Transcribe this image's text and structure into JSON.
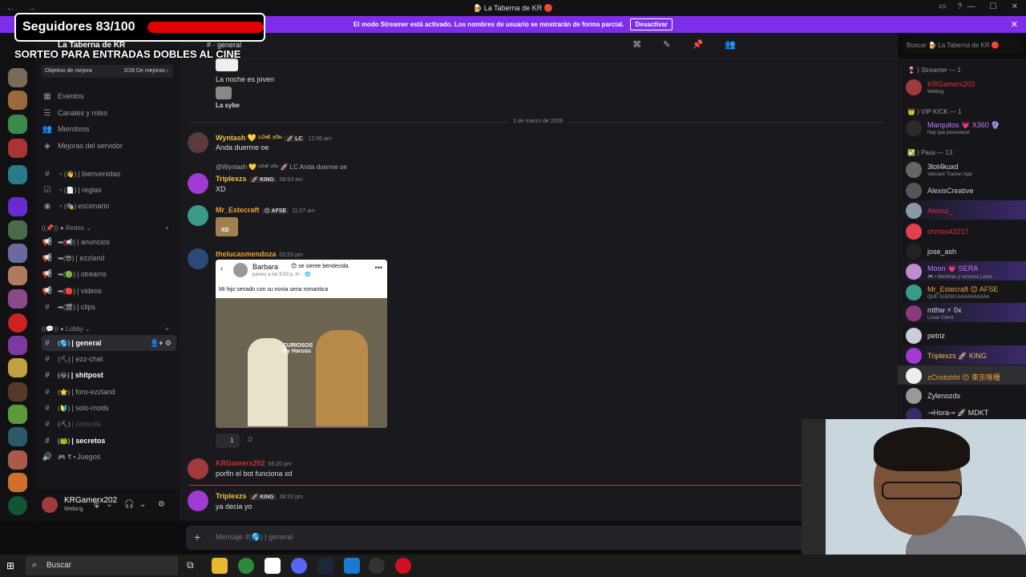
{
  "titlebar": {
    "title": "🍺 La Taberna de KR 🔴",
    "nav": "← →"
  },
  "streamer_banner": {
    "text": "El modo Streamer está activado. Los nombres de usuario se mostrarán de forma parcial.",
    "button": "Desactivar"
  },
  "overlay": {
    "followers": "Seguidores 83/100",
    "followers_current": 83,
    "followers_goal": 100,
    "sorteo": "SORTEO PARA ENTRADAS DOBLES AL CINE"
  },
  "server": {
    "name": "La Taberna de KR",
    "goal_label": "Objetivo de mejora",
    "goal_value": "2/28 De mejoras ›"
  },
  "sidebar": {
    "top_items": [
      {
        "icon": "▦",
        "label": "Eventos"
      },
      {
        "icon": "☰",
        "label": "Canales y roles"
      },
      {
        "icon": "👥",
        "label": "Miembros"
      },
      {
        "icon": "◈",
        "label": "Mejoras del servidor"
      }
    ],
    "channels_a": [
      {
        "icon": "#",
        "emoji": "・(👋)",
        "label": "| bienvenidas"
      },
      {
        "icon": "☑",
        "emoji": "・(📄)",
        "label": "| reglas"
      },
      {
        "icon": "◉",
        "emoji": "・(🎭)",
        "label": "escenario"
      }
    ],
    "cat_redes": "((📌)) ● Redes ⌄",
    "channels_redes": [
      {
        "icon": "📢",
        "emoji": "➡(📢)",
        "label": "| anuncios"
      },
      {
        "icon": "📢",
        "emoji": "➡(😎)",
        "label": "| ezzland"
      },
      {
        "icon": "📢",
        "emoji": "➡(🟢)",
        "label": "| streams"
      },
      {
        "icon": "📢",
        "emoji": "➡(🔴)",
        "label": "| videos"
      },
      {
        "icon": "#",
        "emoji": "➡(🎬)",
        "label": "| clips"
      }
    ],
    "cat_lobby": "((💬)) ● Lobby ⌄",
    "channels_lobby": [
      {
        "icon": "#",
        "emoji": "(🌎)",
        "label": "| general",
        "state": "active"
      },
      {
        "icon": "#",
        "emoji": "(⛏)",
        "label": "| ezz-chat",
        "state": "normal"
      },
      {
        "icon": "#",
        "emoji": "(😂)",
        "label": "| shitpost",
        "state": "bold"
      },
      {
        "icon": "#",
        "emoji": "(🌟)",
        "label": "| foro-ezzland",
        "state": "normal"
      },
      {
        "icon": "#",
        "emoji": "(🔰)",
        "label": "| solo-mods",
        "state": "normal"
      },
      {
        "icon": "#",
        "emoji": "(⛏)",
        "label": "| consola",
        "state": "dim"
      },
      {
        "icon": "#",
        "emoji": "(🐸)",
        "label": "| secretos",
        "state": "bold"
      },
      {
        "icon": "🔊",
        "emoji": "🎮 ₹ •",
        "label": "Juegos",
        "state": "normal"
      }
    ]
  },
  "user": {
    "name": "KRGamerx202",
    "status": "Webing"
  },
  "channel_header": {
    "name": "general"
  },
  "search": {
    "placeholder": "Buscar 🍺 La Taberna de KR 🔴"
  },
  "messages": {
    "m0_text": "La noche es joven",
    "m0_user": "La sybe",
    "date_divider": "1 de marzo de 2026",
    "m1": {
      "user": "Wyntash 💛 ᴸᴼᵛᴱ ʸᴼᵘ",
      "tag": "🚀 LC",
      "time": "12:06 am",
      "text": "Anda duerme oe"
    },
    "m2": {
      "reply": "@Wyntash 💛 ᴸᴼᵛᴱ ʸᴼᵘ  🚀 LC  Anda duerme oe",
      "user": "Triplexzs",
      "tag": "🚀 KING",
      "time": "08:53 am",
      "text": "XD"
    },
    "m3": {
      "user": "Mr_Estecraft",
      "tag": "😊 AFSE",
      "time": "11:27 am",
      "text": "XD"
    },
    "m4": {
      "user": "thelucasmendoza",
      "time": "03:53 pm",
      "meme_name": "Barbara",
      "meme_feel": "😊 se siente bendecida.",
      "meme_when": "jueves a las 9:53 p. m. · 🌐",
      "meme_caption": "Mi hijo senado con su novia sena romantica",
      "meme_watermark": "CURIOSOS By Harusu",
      "reaction_count": "1"
    },
    "m5": {
      "user": "KRGamerx202",
      "time": "08:20 pm",
      "text": "porfin el bot funciona xd"
    },
    "m6": {
      "user": "Triplexzs",
      "tag": "🚀 KING",
      "time": "08:20 pm",
      "text": "ya decia yo"
    }
  },
  "input": {
    "placeholder": "Mensaje #(🌎) | general"
  },
  "members": {
    "cat_streamer": "🍷 ) Streamer — 1",
    "cat_vip": "👑 ) VIP KICK — 1",
    "cat_pass": "✅ ) Pass — 13",
    "list": [
      {
        "name": "KRGamerx202",
        "sub": "Webing",
        "color": "#e03030"
      },
      {
        "name": "Marquitos 💗 X360 🔮",
        "sub": "Hay que perseverar",
        "color": "#c57bff"
      },
      {
        "name": "3lot4kuxd",
        "sub": "Valorant Tracker App",
        "color": "#ddd"
      },
      {
        "name": "AlexisCreative",
        "sub": "",
        "color": "#ccc"
      },
      {
        "name": "Alexsz_",
        "sub": "",
        "color": "#e03030"
      },
      {
        "name": "christo43217",
        "sub": "",
        "color": "#e03030"
      },
      {
        "name": "jose_ash",
        "sub": "",
        "color": "#ddd"
      },
      {
        "name": "Moon 💗 SERA",
        "sub": "🎮 • Mentiras y censura Lunar...",
        "color": "#c57bff"
      },
      {
        "name": "Mr_Estecraft 😊 AFSE",
        "sub": "QUE SUENO AAAAAAAAAA",
        "color": "#f0a030"
      },
      {
        "name": "mthw ⚡ 0x",
        "sub": "Lunar Client",
        "color": "#ddd"
      },
      {
        "name": "petriz",
        "sub": "",
        "color": "#ddd"
      },
      {
        "name": "Triplexzs 🚀 KING",
        "sub": "",
        "color": "#f0c040"
      },
      {
        "name": "zCristohht 😊 東京喰種",
        "sub": "",
        "color": "#f0a030"
      },
      {
        "name": "Zylenozds",
        "sub": "",
        "color": "#ddd"
      },
      {
        "name": "⊸Hora⊸ 🚀 MDKT",
        "sub": "",
        "color": "#ddd"
      }
    ]
  },
  "taskbar": {
    "search": "Buscar"
  }
}
